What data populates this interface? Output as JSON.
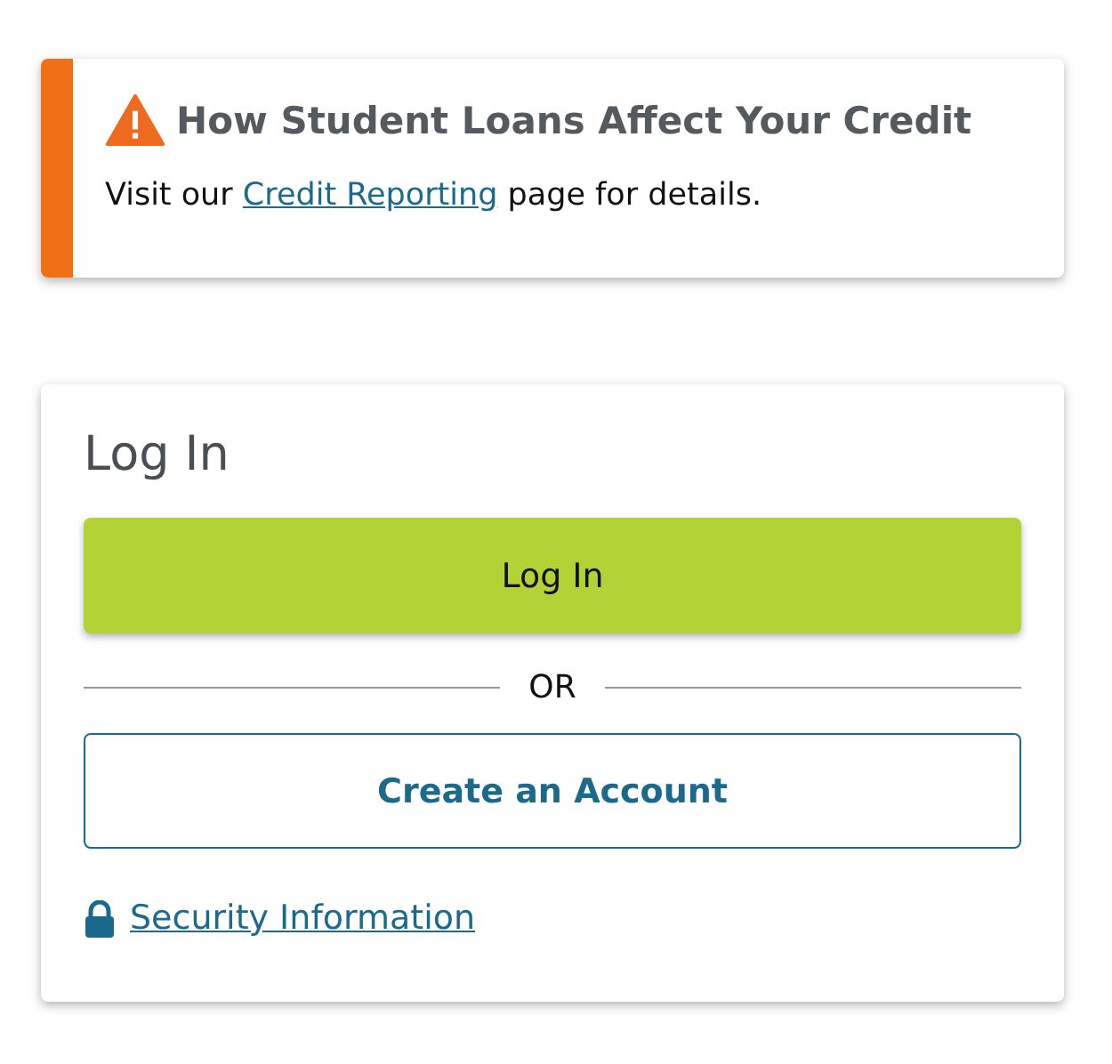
{
  "alert": {
    "title": "How Student Loans Affect Your Credit",
    "text_before": "Visit our ",
    "link": "Credit Reporting",
    "text_after": " page for details."
  },
  "login": {
    "heading": "Log In",
    "login_button": "Log In",
    "divider": "OR",
    "create_button": "Create an Account",
    "security_link": "Security Information"
  }
}
